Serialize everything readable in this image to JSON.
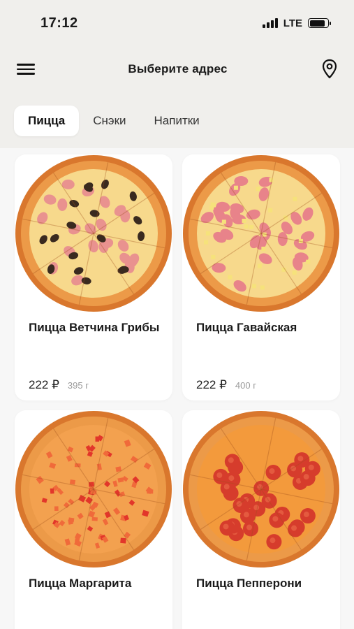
{
  "status_bar": {
    "time": "17:12",
    "network": "LTE",
    "battery_level": 0.85
  },
  "header": {
    "title": "Выберите адрес",
    "menu_icon": "menu-icon",
    "location_icon": "location-pin-icon"
  },
  "tabs": [
    {
      "label": "Пицца",
      "active": true
    },
    {
      "label": "Снэки",
      "active": false
    },
    {
      "label": "Напитки",
      "active": false
    }
  ],
  "products": [
    {
      "name": "Пицца Ветчина Грибы",
      "price": "222 ₽",
      "weight": "395 г",
      "topping": "ham-mushroom"
    },
    {
      "name": "Пицца Гавайская",
      "price": "222 ₽",
      "weight": "400 г",
      "topping": "hawaiian"
    },
    {
      "name": "Пицца Маргарита",
      "price": "",
      "weight": "",
      "topping": "margherita"
    },
    {
      "name": "Пицца Пепперони",
      "price": "",
      "weight": "",
      "topping": "pepperoni"
    }
  ],
  "colors": {
    "background": "#f0efec",
    "card": "#ffffff",
    "crust": "#e08a3c",
    "cheese": "#f6d27a"
  }
}
